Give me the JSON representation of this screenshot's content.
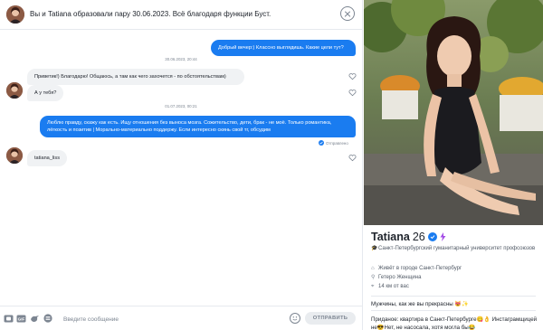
{
  "chat": {
    "header_text": "Вы и Tatiana образовали пару 30.06.2023. Всё благодаря функции Буст.",
    "messages": {
      "m1": "Добрый вечер:) Классно выглядишь. Какие цели тут?",
      "ts1": "30.06.2023, 20:44",
      "m2": "Приветик!) Благодарю! Общаюсь, а там как чего захочется - по обстоятельствам)",
      "m3": "А у тебя?",
      "ts2": "01.07.2023, 00:21",
      "m4": "Люблю правду, скажу как есть. Ищу отношения без выноса мозга. Сожительство, дети, брак - не моё. Только романтика, лёгкость и позитив | Морально-материально поддержу. Если интересно скинь свой тг, обсудим",
      "status": "Отправлено",
      "m5": "tatiana_liss"
    },
    "compose": {
      "placeholder": "Введите сообщение",
      "send_label": "ОТПРАВИТЬ",
      "tools": [
        "sticker-icon",
        "gif-icon",
        "bird-icon",
        "list-icon",
        "emoji-icon"
      ]
    }
  },
  "profile": {
    "name": "Tatiana",
    "age": "26",
    "education": "Санкт-Петербургский гуманитарный университет профсоюзов",
    "city": "Живёт в городе Санкт-Петербург",
    "orientation": "Гетеро Женщина",
    "distance": "14 км от вас",
    "bio": "Мужчины, как же вы прекрасны 😻✨",
    "bio2": "Приданое: квартира в Санкт-Петербурге😋👌 Инстаграмщицей не😎Нет, не насосала, хотя могла бы😂"
  },
  "colors": {
    "accent": "#1a7cf0",
    "bubble_in": "#f0f2f4"
  }
}
